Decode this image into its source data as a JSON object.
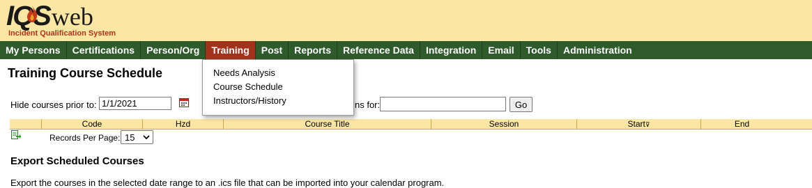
{
  "app": {
    "logo_ios": "IQS",
    "logo_web": "web",
    "logo_tagline": "Incident Qualification System"
  },
  "nav": {
    "items": [
      {
        "label": "My Persons"
      },
      {
        "label": "Certifications"
      },
      {
        "label": "Person/Org"
      },
      {
        "label": "Training"
      },
      {
        "label": "Post"
      },
      {
        "label": "Reports"
      },
      {
        "label": "Reference Data"
      },
      {
        "label": "Integration"
      },
      {
        "label": "Email"
      },
      {
        "label": "Tools"
      },
      {
        "label": "Administration"
      }
    ],
    "active": "Training",
    "active_color": "#a3321d",
    "bar_color": "#2f5a2b"
  },
  "training_menu": {
    "items": [
      "Needs Analysis",
      "Course Schedule",
      "Instructors/History"
    ]
  },
  "page": {
    "title": "Training Course Schedule"
  },
  "filters": {
    "hide_label": "Hide courses prior to:",
    "hide_value": "1/1/2021",
    "search_label_visible": "ns for:",
    "search_value": "",
    "go_label": "Go"
  },
  "table": {
    "columns": [
      "Code",
      "Hzd",
      "Course Title",
      "Session",
      "Start",
      "End"
    ],
    "sort_indicator": "⊽"
  },
  "paging": {
    "records_label": "Records Per Page:",
    "records_value": "15"
  },
  "export": {
    "title": "Export Scheduled Courses",
    "description": "Export the courses in the selected date range to an .ics file that can be imported into your calendar program."
  }
}
